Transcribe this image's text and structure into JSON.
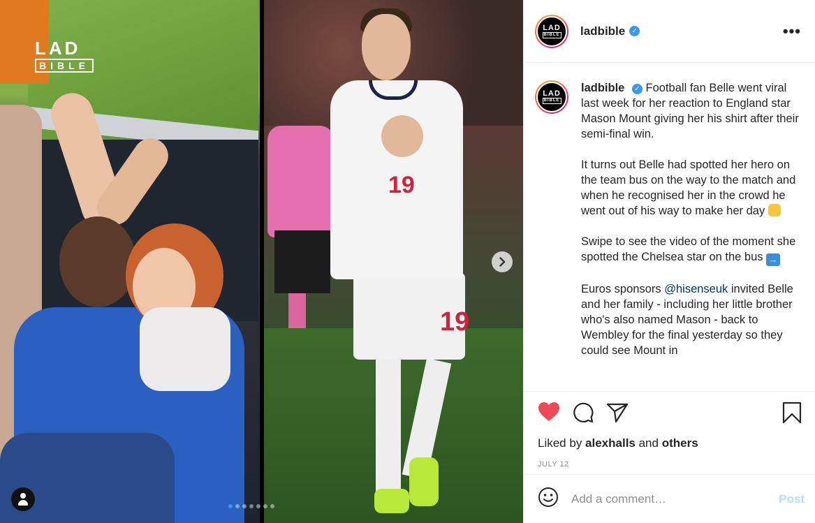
{
  "media": {
    "watermark_line1": "LAD",
    "watermark_line2": "BIBLE",
    "shirt_number": "19",
    "shorts_number": "19",
    "carousel_dots": 7,
    "active_dot": 0
  },
  "header": {
    "username": "ladbible",
    "avatar_line1": "LAD",
    "avatar_line2": "BIBLE",
    "verified_glyph": "✓",
    "more_glyph": "•••"
  },
  "caption": {
    "username": "ladbible",
    "p1": "Football fan Belle went viral last week for her reaction to England star Mason Mount giving her his shirt after their semi-final win.",
    "p2": "It turns out Belle had spotted her hero on the team bus on the way to the match and when he recognised her in the crowd he went out of his way to make her day",
    "p3": "Swipe to see the video of the moment she spotted the Chelsea star on the bus",
    "p4_before": "Euros sponsors ",
    "p4_mention": "@hisenseuk",
    "p4_after": " invited Belle and her family - including her little brother who's also named Mason - back to Wembley for the final yesterday so they could see Mount in"
  },
  "actions": {
    "like_icon": "heart-filled",
    "liked_prefix": "Liked by ",
    "liked_user": "alexhalls",
    "liked_and": " and ",
    "liked_others": "others",
    "date": "JULY 12",
    "accent_like": "#ed4956"
  },
  "comment": {
    "placeholder": "Add a comment…",
    "post_label": "Post"
  }
}
